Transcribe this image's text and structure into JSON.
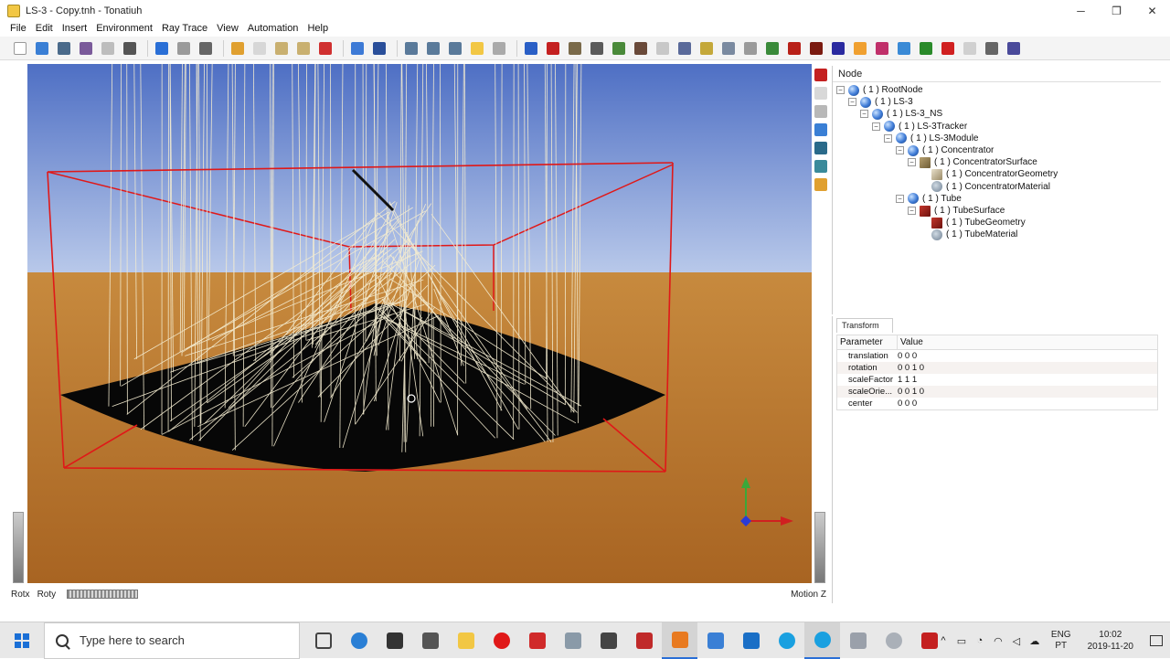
{
  "window": {
    "title": "LS-3 - Copy.tnh - Tonatiuh",
    "minimize_glyph": "─",
    "maximize_glyph": "❐",
    "close_glyph": "✕"
  },
  "menu": [
    "File",
    "Edit",
    "Insert",
    "Environment",
    "Ray Trace",
    "View",
    "Automation",
    "Help"
  ],
  "toolbar": {
    "icons": [
      {
        "name": "new-file-icon",
        "color": "#ffffff"
      },
      {
        "name": "open-file-icon",
        "color": "#3a7fd5"
      },
      {
        "name": "save-icon",
        "color": "#4a6a8a"
      },
      {
        "name": "save-as-icon",
        "color": "#7a5a9a"
      },
      {
        "name": "print-icon",
        "color": "#bdbdbd"
      },
      {
        "name": "stop-icon",
        "color": "#555555"
      },
      {
        "name": "undo-icon",
        "color": "#2a6fd6"
      },
      {
        "name": "redo-icon",
        "color": "#9a9a9a"
      },
      {
        "name": "dropdown-icon",
        "color": "#666666"
      },
      {
        "name": "cut-icon",
        "color": "#e0a030"
      },
      {
        "name": "copy-icon",
        "color": "#d7d7d7"
      },
      {
        "name": "paste-icon",
        "color": "#c9b070"
      },
      {
        "name": "paste-link-icon",
        "color": "#c9b070"
      },
      {
        "name": "delete-icon",
        "color": "#d03030"
      },
      {
        "name": "settings-gear-icon",
        "color": "#3d7ad6"
      },
      {
        "name": "sun-icon",
        "color": "#2a4f9a"
      },
      {
        "name": "view-front-icon",
        "color": "#5a7a9a"
      },
      {
        "name": "view-side-icon",
        "color": "#5a7a9a"
      },
      {
        "name": "view-top-icon",
        "color": "#5a7a9a"
      },
      {
        "name": "sun-position-icon",
        "color": "#f2c744"
      },
      {
        "name": "grid-icon",
        "color": "#aaaaaa"
      },
      {
        "name": "sphere-node-icon",
        "color": "#2a5fc6"
      },
      {
        "name": "ray-trace-icon",
        "color": "#c42020"
      },
      {
        "name": "tracker-icon",
        "color": "#7a6a4a"
      },
      {
        "name": "axis-icon",
        "color": "#5a5a5a"
      },
      {
        "name": "heliostat-icon",
        "color": "#4a8a3a"
      },
      {
        "name": "material-icon",
        "color": "#6a4a3a"
      },
      {
        "name": "sphere-shape-icon",
        "color": "#c8c8c8"
      },
      {
        "name": "parabola-icon",
        "color": "#5a6a9a"
      },
      {
        "name": "checker-icon",
        "color": "#c4a83a"
      },
      {
        "name": "cone-icon",
        "color": "#7a8aa0"
      },
      {
        "name": "plane-icon",
        "color": "#9a9a9a"
      },
      {
        "name": "cylinder-icon",
        "color": "#3a8a3a"
      },
      {
        "name": "tube-icon",
        "color": "#b82018"
      },
      {
        "name": "disk-icon",
        "color": "#7a1a10"
      },
      {
        "name": "rectangle-icon",
        "color": "#2a2aa0"
      },
      {
        "name": "triangle-icon",
        "color": "#f0a030"
      },
      {
        "name": "hyperbola-icon",
        "color": "#c0306a"
      },
      {
        "name": "spiral-icon",
        "color": "#3a8ad6"
      },
      {
        "name": "flat-disk-icon",
        "color": "#2a8a2a"
      },
      {
        "name": "red-sphere-icon",
        "color": "#d02020"
      },
      {
        "name": "box-icon",
        "color": "#d0d0d0"
      },
      {
        "name": "more-icon",
        "color": "#666666"
      },
      {
        "name": "settings-window-icon",
        "color": "#4a4a9a"
      }
    ]
  },
  "tree": {
    "header": "Node",
    "nodes": [
      {
        "label": "( 1 )  RootNode",
        "icon": "sphere"
      },
      {
        "label": "( 1 )  LS-3",
        "icon": "sphere"
      },
      {
        "label": "( 1 )  LS-3_NS",
        "icon": "sphere"
      },
      {
        "label": "( 1 )  LS-3Tracker",
        "icon": "sphere"
      },
      {
        "label": "( 1 )  LS-3Module",
        "icon": "sphere"
      },
      {
        "label": "( 1 )  Concentrator",
        "icon": "sphere"
      },
      {
        "label": "( 1 )  ConcentratorSurface",
        "icon": "shape"
      },
      {
        "label": "( 1 )  ConcentratorGeometry",
        "icon": "geom"
      },
      {
        "label": "( 1 )  ConcentratorMaterial",
        "icon": "mat"
      },
      {
        "label": "( 1 )  Tube",
        "icon": "sphere"
      },
      {
        "label": "( 1 )  TubeSurface",
        "icon": "tube"
      },
      {
        "label": "( 1 )  TubeGeometry",
        "icon": "tube"
      },
      {
        "label": "( 1 )  TubeMaterial",
        "icon": "mat"
      }
    ]
  },
  "transform": {
    "tab": "Transform",
    "col_param": "Parameter",
    "col_value": "Value",
    "rows": [
      {
        "param": "translation",
        "value": "0 0 0"
      },
      {
        "param": "rotation",
        "value": "0 0 1  0"
      },
      {
        "param": "scaleFactor",
        "value": "1 1 1"
      },
      {
        "param": "scaleOrie...",
        "value": "0 0 1  0"
      },
      {
        "param": "center",
        "value": "0 0 0"
      }
    ]
  },
  "status": {
    "rotx": "Rotx",
    "roty": "Roty",
    "motionz": "Motion Z"
  },
  "taskbar": {
    "search_placeholder": "Type here to search",
    "lang_1": "ENG",
    "lang_2": "PT",
    "time": "10:02",
    "date": "2019-11-20"
  }
}
